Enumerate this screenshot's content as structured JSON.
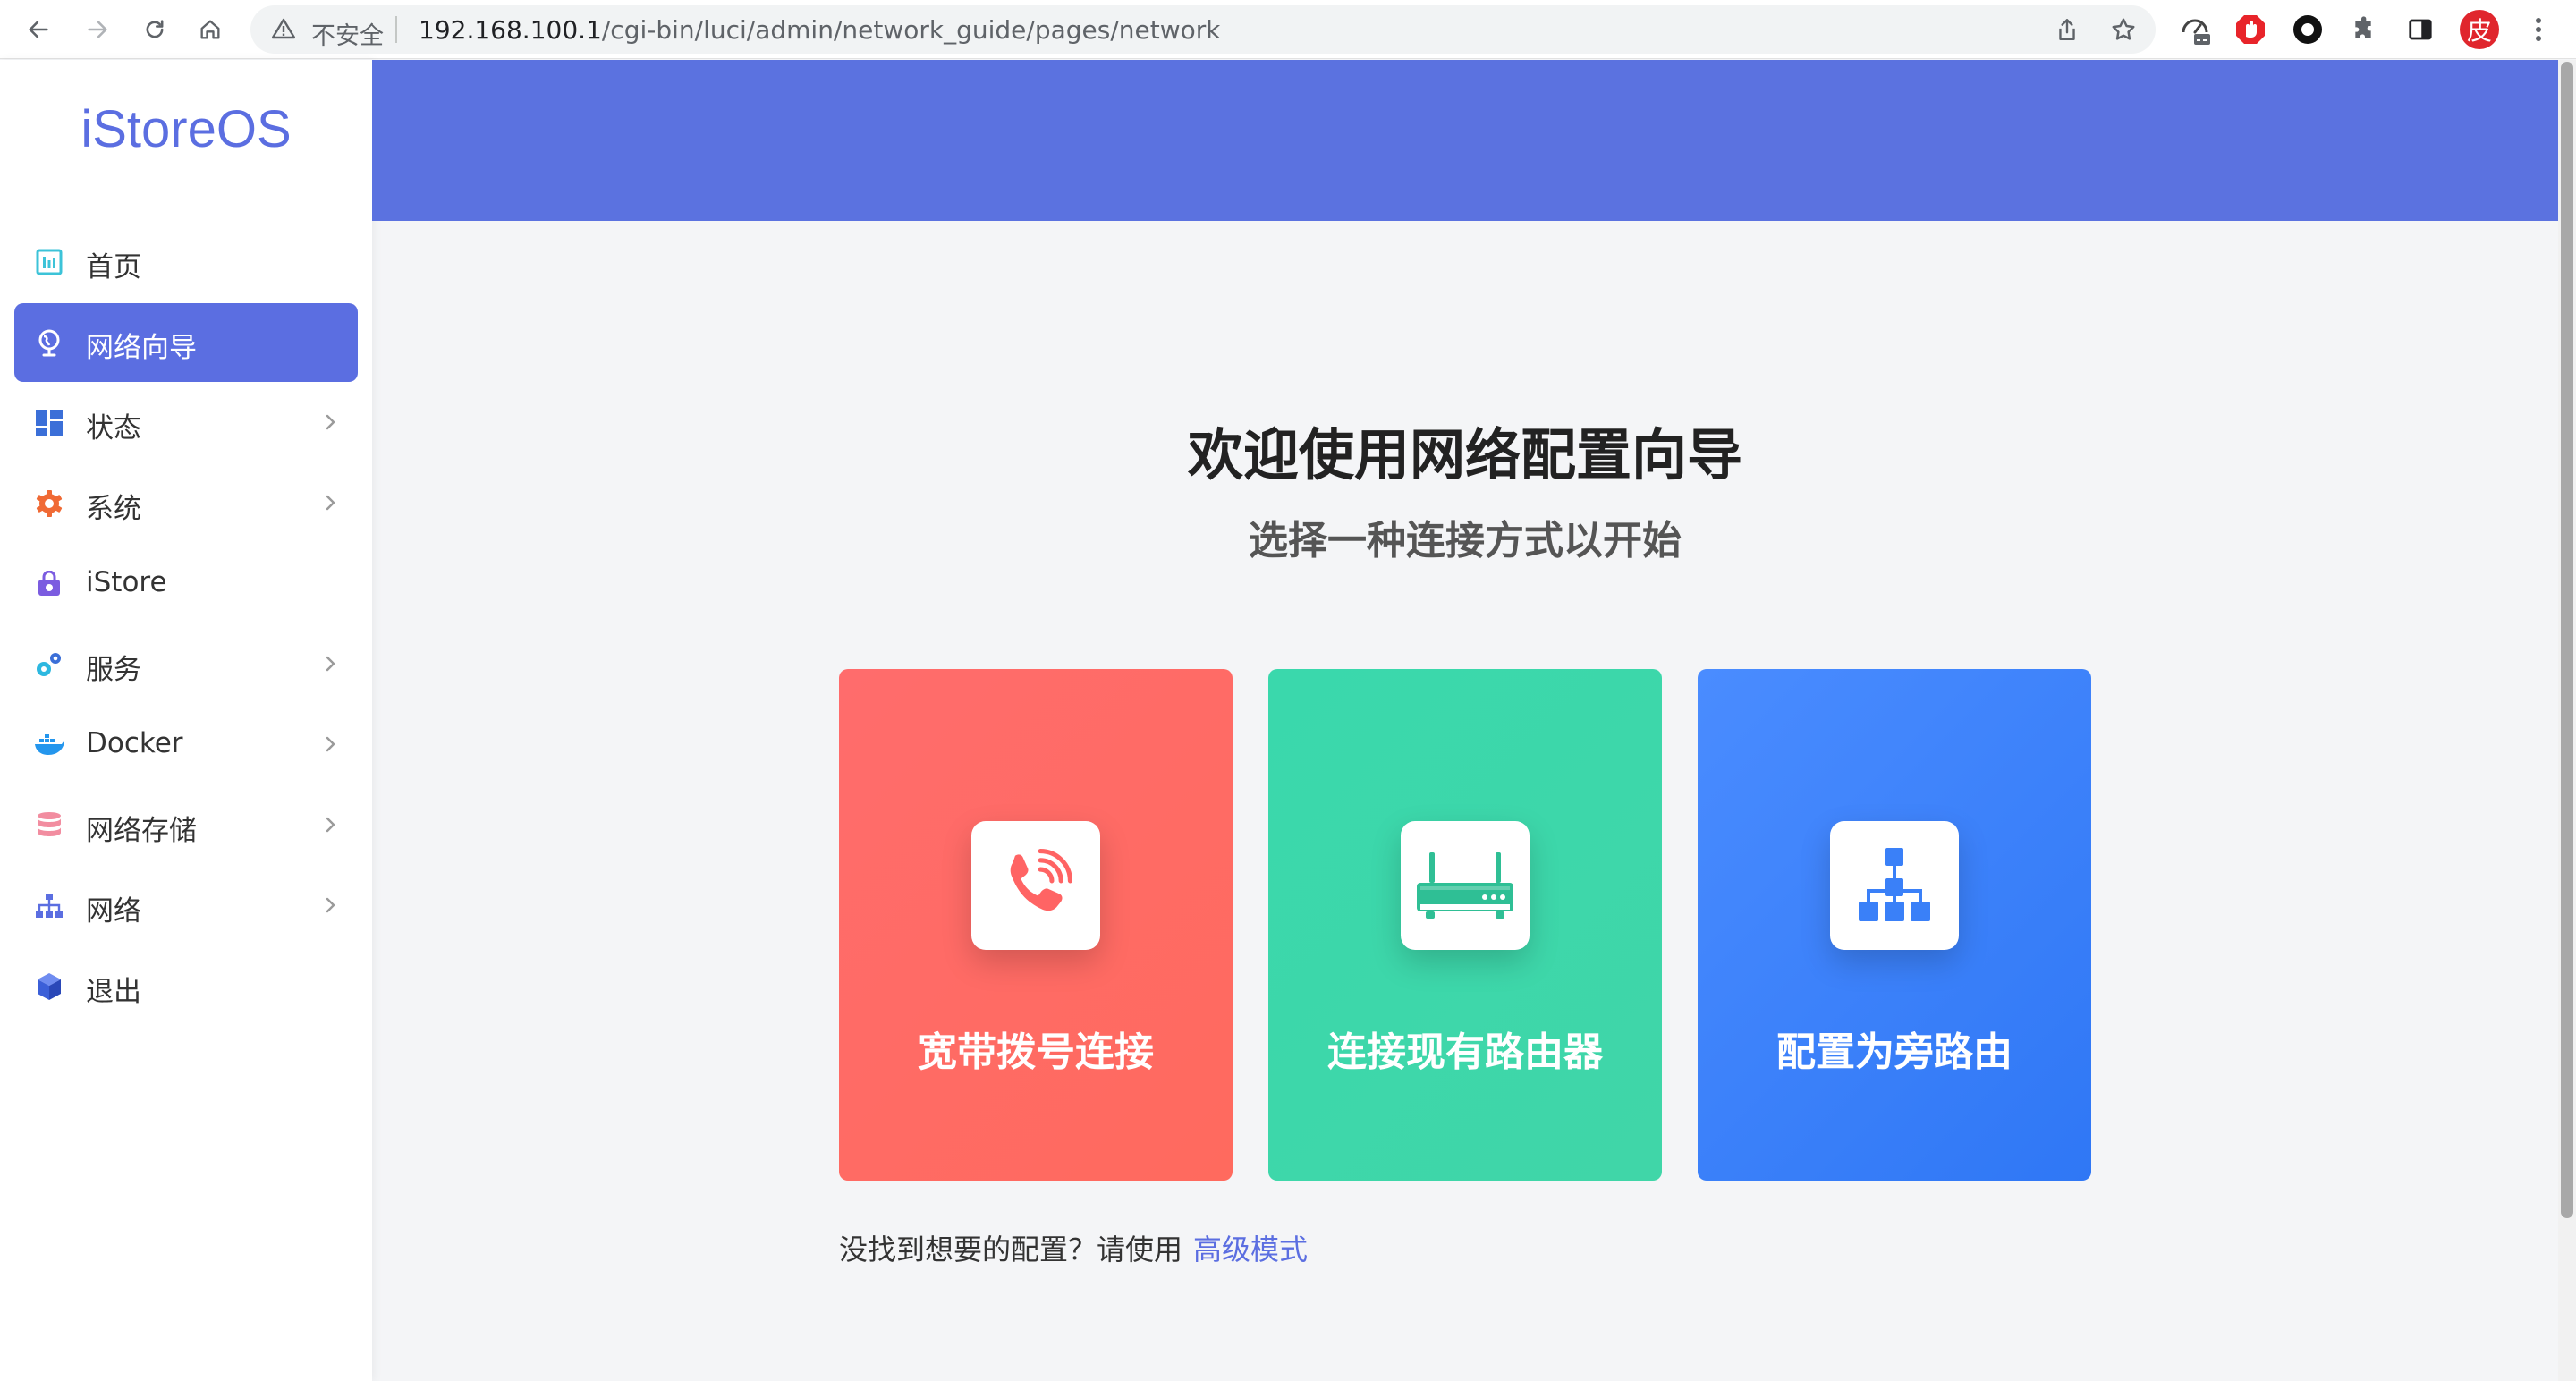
{
  "browser": {
    "security_label": "不安全",
    "url_host": "192.168.100.1",
    "url_path": "/cgi-bin/luci/admin/network_guide/pages/network",
    "profile_char": "皮"
  },
  "sidebar": {
    "logo": "iStoreOS",
    "items": [
      {
        "label": "首页",
        "icon": "dashboard-icon"
      },
      {
        "label": "网络向导",
        "icon": "globe-icon",
        "active": true
      },
      {
        "label": "状态",
        "icon": "grid-icon"
      },
      {
        "label": "系统",
        "icon": "gear-icon"
      },
      {
        "label": "iStore",
        "icon": "store-bag-icon"
      },
      {
        "label": "服务",
        "icon": "cogs-icon"
      },
      {
        "label": "Docker",
        "icon": "docker-icon"
      },
      {
        "label": "网络存储",
        "icon": "database-icon"
      },
      {
        "label": "网络",
        "icon": "network-tree-icon"
      },
      {
        "label": "退出",
        "icon": "cube-icon"
      }
    ]
  },
  "main": {
    "title": "欢迎使用网络配置向导",
    "subtitle": "选择一种连接方式以开始",
    "cards": [
      {
        "label": "宽带拨号连接",
        "icon": "phone-icon",
        "color": "#ff6b6b"
      },
      {
        "label": "连接现有路由器",
        "icon": "router-icon",
        "color": "#3dd6a9"
      },
      {
        "label": "配置为旁路由",
        "icon": "topology-icon",
        "color": "#3a80f8"
      }
    ],
    "footer_text": "没找到想要的配置？请使用",
    "footer_link": "高级模式"
  },
  "colors": {
    "accent": "#5b6ee1",
    "banner": "#5b72e0"
  }
}
